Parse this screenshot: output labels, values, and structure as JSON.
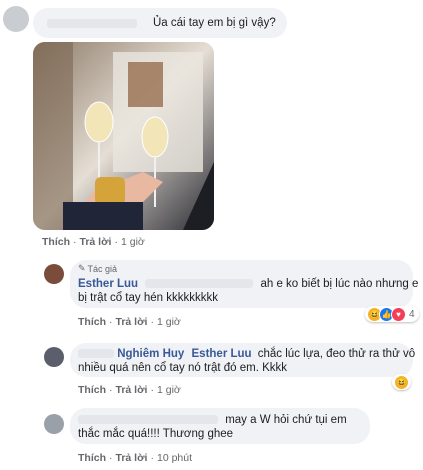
{
  "comments": [
    {
      "text": "Ủa cái tay em bị gì vậy?",
      "actions": {
        "like": "Thích",
        "reply": "Trả lời",
        "time": "1 giờ"
      }
    },
    {
      "author_badge": "Tác giả",
      "author": "Esther Luu",
      "text_line1": "ah e ko biết bị lúc nào nhưng e",
      "text_line2": "bị trật cổ tay hén kkkkkkkkk",
      "actions": {
        "like": "Thích",
        "reply": "Trả lời",
        "time": "1 giờ"
      },
      "reaction_count": "4"
    },
    {
      "author_partial": "Nghiêm Huy",
      "mention": "Esther Luu",
      "text_line1": "chắc lúc lựa, đeo thử ra thử vô",
      "text_line2": "nhiều quá nên cổ tay nó trật đó em. Kkkk",
      "actions": {
        "like": "Thích",
        "reply": "Trả lời",
        "time": "1 giờ"
      }
    },
    {
      "text_line1": "may a W hỏi chứ tụi em",
      "text_line2": "thắc mắc quá!!!! Thương ghee",
      "actions": {
        "like": "Thích",
        "reply": "Trả lời",
        "time": "10 phút"
      }
    }
  ],
  "icons": {
    "more": "more-horizontal-icon",
    "author_badge": "pencil-badge-icon",
    "reactions": [
      "haha-icon",
      "like-icon",
      "love-icon"
    ]
  },
  "colors": {
    "bubble": "#f0f2f5",
    "link": "#385898",
    "meta": "#65676b",
    "like": "#1877f2",
    "love": "#f33e58",
    "haha": "#f7b125"
  }
}
